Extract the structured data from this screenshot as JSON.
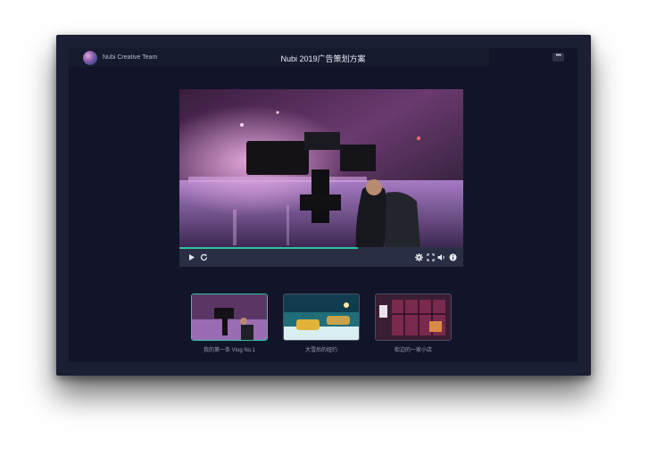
{
  "header": {
    "team_name": "Nubi Creative Team",
    "title": "Nubi 2019广告策划方案",
    "more_label": "•••"
  },
  "player": {
    "progress": 0.63,
    "accent": "#2fc3a0",
    "controls": {
      "play_icon": "play-icon",
      "loop_icon": "loop-icon",
      "settings_icon": "gear-icon",
      "fullscreen_icon": "fullscreen-icon",
      "volume_icon": "volume-icon",
      "info_icon": "info-icon"
    }
  },
  "playlist": [
    {
      "caption": "我的第一条 Vlog No.1",
      "active": true
    },
    {
      "caption": "大雪后的纽约",
      "active": false
    },
    {
      "caption": "街边的一家小店",
      "active": false
    }
  ]
}
